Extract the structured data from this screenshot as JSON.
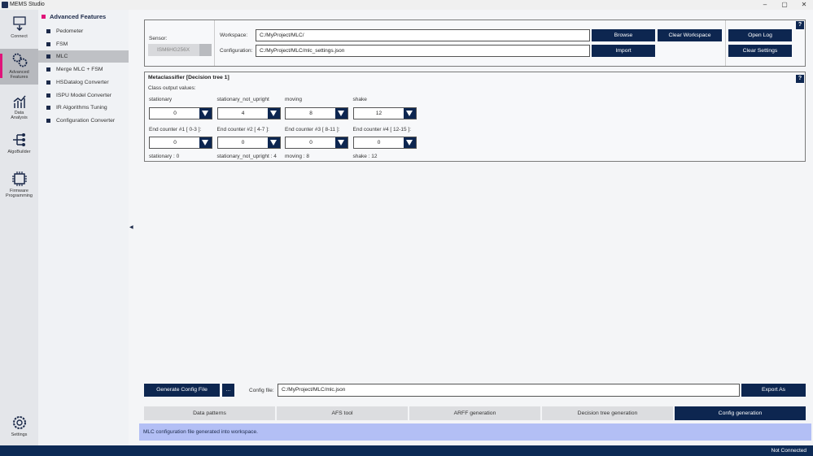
{
  "app": {
    "title": "MEMS Studio"
  },
  "colors": {
    "accent": "#e0147a",
    "navy": "#0d2650",
    "status_bg": "#b3bff5",
    "bottombar": "#0d2a55"
  },
  "nav": [
    {
      "label1": "Connect",
      "label2": "",
      "icon": "connect-icon"
    },
    {
      "label1": "Advanced",
      "label2": "Features",
      "icon": "gears-icon"
    },
    {
      "label1": "Data",
      "label2": "Analysis",
      "icon": "chart-icon"
    },
    {
      "label1": "AlgoBuilder",
      "label2": "",
      "icon": "algobuilder-icon"
    },
    {
      "label1": "Firmware",
      "label2": "Programming",
      "icon": "chip-icon"
    }
  ],
  "settings": {
    "label": "Settings"
  },
  "submenu": {
    "title": "Advanced Features",
    "items": [
      "Pedometer",
      "FSM",
      "MLC",
      "Merge MLC + FSM",
      "HSDatalog Converter",
      "ISPU Model Converter",
      "IR Algorithms Tuning",
      "Configuration Converter"
    ],
    "active": "MLC"
  },
  "top": {
    "sensor_label": "Sensor:",
    "sensor_value": "ISM6HG256X",
    "workspace_label": "Workspace:",
    "workspace_value": "C:/MyProject/MLC/",
    "configuration_label": "Configuration:",
    "configuration_value": "C:/MyProject/MLC/mlc_settings.json",
    "browse": "Browse",
    "clear_workspace": "Clear Workspace",
    "import": "Import",
    "open_log": "Open Log",
    "clear_settings": "Clear Settings",
    "help": "?"
  },
  "meta": {
    "title": "Metaclassifier [Decision tree 1]",
    "subtitle": "Class output values:",
    "help": "?",
    "classes": [
      {
        "name": "stationary",
        "value": "0",
        "counter_label": "End counter #1 [ 0-3 ]:",
        "counter": "0",
        "summary": "stationary : 0"
      },
      {
        "name": "stationary_not_upright",
        "value": "4",
        "counter_label": "End counter #2 [ 4-7 ]:",
        "counter": "0",
        "summary": "stationary_not_upright : 4"
      },
      {
        "name": "moving",
        "value": "8",
        "counter_label": "End counter #3 [ 8-11 ]:",
        "counter": "0",
        "summary": "moving : 8"
      },
      {
        "name": "shake",
        "value": "12",
        "counter_label": "End counter #4 [ 12-15 ]:",
        "counter": "0",
        "summary": "shake : 12"
      }
    ]
  },
  "bottom": {
    "generate": "Generate Config File",
    "dots": "...",
    "config_label": "Config file:",
    "config_value": "C:/MyProject/MLC/mlc.json",
    "export": "Export As"
  },
  "tabs": [
    "Data patterns",
    "AFS tool",
    "ARFF generation",
    "Decision tree generation",
    "Config generation"
  ],
  "status": "MLC configuration file generated into workspace.",
  "connection": "Not Connected",
  "window": {
    "minimize": "–",
    "maximize": "▢",
    "close": "✕"
  }
}
